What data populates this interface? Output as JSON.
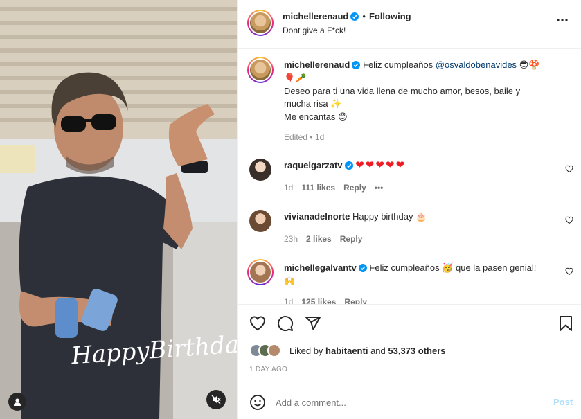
{
  "post": {
    "author": "michellerenaud",
    "follow_status": "Following",
    "bio": "Dont give a F*ck!",
    "overlay_text": "HappyBirthday!"
  },
  "caption": {
    "username": "michellerenaud",
    "text_before": "Feliz cumpleaños ",
    "mention": "@osvaldobenavides",
    "emoji_1": "😎🍄",
    "line2_emoji": "🎈🥕",
    "line3": "Deseo para ti una vida llena de mucho amor, besos, baile y",
    "line4": "mucha risa",
    "line4_emoji": "✨",
    "line5": "Me encantas",
    "line5_emoji": "😊",
    "meta": "Edited • 1d"
  },
  "comments": [
    {
      "username": "raquelgarzatv",
      "text": "❤❤❤❤❤",
      "time": "1d",
      "likes": "111 likes",
      "reply": "Reply",
      "more": "•••"
    },
    {
      "username": "vivianadelnorte",
      "text": "Happy birthday",
      "emoji": "🎂",
      "time": "23h",
      "likes": "2 likes",
      "reply": "Reply"
    },
    {
      "username": "michellegalvantv",
      "text_before": "Feliz cumpleaños ",
      "emoji": "🥳",
      "text_after": " que la pasen genial!",
      "emoji2": "🙌",
      "time": "1d",
      "likes": "125 likes",
      "reply": "Reply"
    }
  ],
  "likes": {
    "liked_by_prefix": "Liked by ",
    "liked_by_user": "habitaenti",
    "and": " and ",
    "others": "53,373 others"
  },
  "date": "1 DAY AGO",
  "add_comment": {
    "placeholder": "Add a comment...",
    "post_label": "Post"
  },
  "icons": {
    "more": "more-horizontal-icon",
    "like": "heart-icon",
    "comment": "comment-icon",
    "share": "send-icon",
    "save": "bookmark-icon",
    "emoji": "smile-icon",
    "mute": "muted-speaker-icon",
    "tags": "user-icon"
  },
  "colors": {
    "verified": "#0095f6",
    "link": "#00376b",
    "post_disabled": "#b2dffc"
  }
}
